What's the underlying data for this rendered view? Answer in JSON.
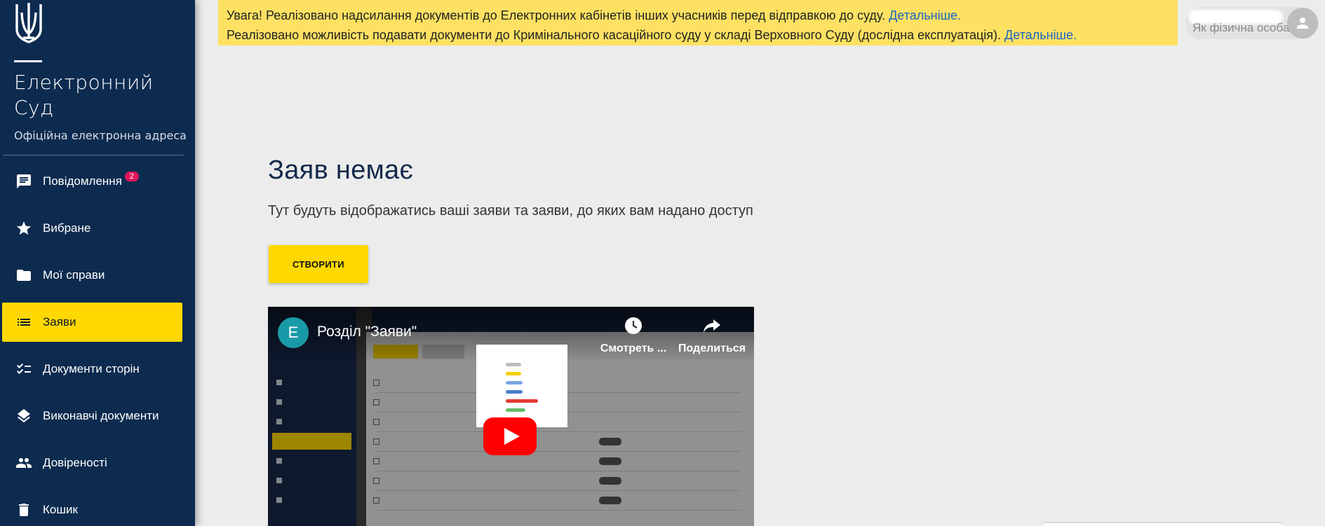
{
  "app": {
    "brand_title": "Електронний Суд",
    "brand_subtitle": "Офіційна електронна адреса"
  },
  "sidebar": {
    "items": [
      {
        "label": "Повідомлення",
        "icon": "message-icon",
        "badge": "2",
        "active": false
      },
      {
        "label": "Вибране",
        "icon": "star-icon",
        "active": false
      },
      {
        "label": "Мої справи",
        "icon": "folder-icon",
        "active": false
      },
      {
        "label": "Заяви",
        "icon": "list-icon",
        "active": true
      },
      {
        "label": "Документи сторін",
        "icon": "checklist-icon",
        "active": false
      },
      {
        "label": "Виконавчі документи",
        "icon": "layers-icon",
        "active": false
      },
      {
        "label": "Довіреності",
        "icon": "people-icon",
        "active": false
      },
      {
        "label": "Кошик",
        "icon": "trash-icon",
        "active": false
      }
    ]
  },
  "notice": {
    "line1_text": "Увага! Реалізовано надсилання документів до Електронних кабінетів інших учасників перед відправкою до суду.",
    "line1_link": "Детальніше.",
    "line2_text": "Реалізовано можливість подавати документи до Кримінального касаційного суду у складі Верховного Суду (дослідна експлуатація).",
    "line2_link": "Детальніше."
  },
  "user": {
    "role": "Як фізична особа"
  },
  "main": {
    "empty_title": "Заяв немає",
    "empty_description": "Тут будуть відображатись ваші заяви та заяви, до яких вам надано доступ",
    "create_button": "СТВОРИТИ"
  },
  "video": {
    "channel_initial": "E",
    "title": "Розділ \"Заяви\"",
    "watch_later": "Смотреть ...",
    "share": "Поделиться"
  },
  "colors": {
    "sidebar_bg": "#0d2b4f",
    "accent_yellow": "#fed800",
    "notice_bg": "#fee162",
    "link": "#1a63c4",
    "badge": "#e2165c"
  }
}
